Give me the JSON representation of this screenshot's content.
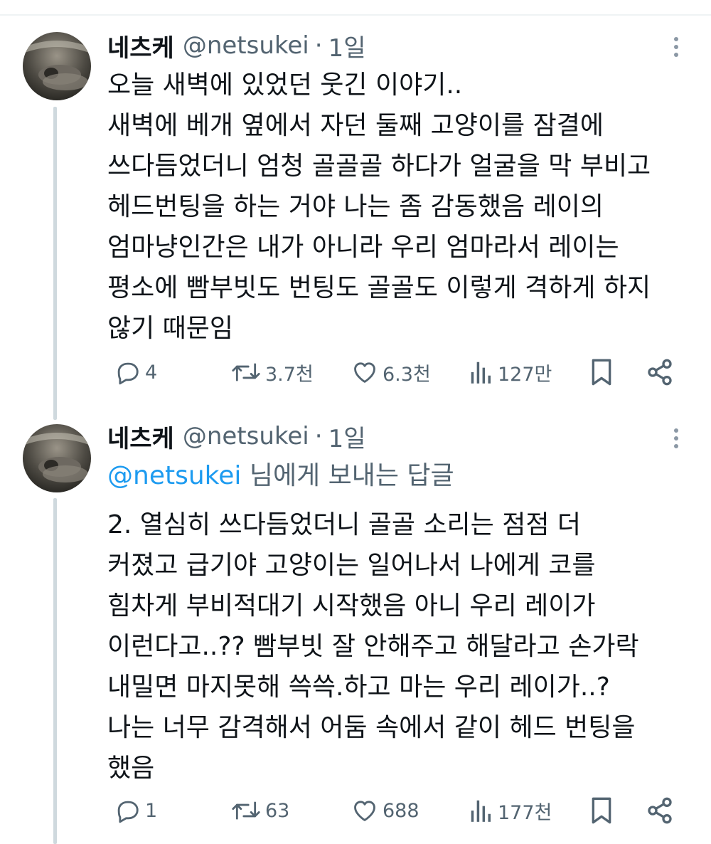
{
  "tweets": [
    {
      "name": "네츠케",
      "handle": "@netsukei",
      "dot": "·",
      "time": "1일",
      "text": "오늘 새벽에 있었던 웃긴 이야기..\n새벽에 베개 옆에서 자던 둘째 고양이를 잠결에\n쓰다듬었더니 엄청 골골골 하다가 얼굴을 막 부비고\n헤드번팅을 하는 거야 나는 좀 감동했음 레이의\n엄마냥인간은 내가 아니라 우리 엄마라서 레이는\n평소에 빰부빗도 번팅도 골골도 이렇게 격하게 하지\n않기 때문임",
      "stats": {
        "replies": "4",
        "retweets": "3.7천",
        "likes": "6.3천",
        "views": "127만"
      }
    },
    {
      "name": "네츠케",
      "handle": "@netsukei",
      "dot": "·",
      "time": "1일",
      "replying_mention": "@netsukei",
      "replying_rest": " 님에게 보내는 답글",
      "text": "2. 열심히 쓰다듬었더니 골골 소리는 점점 더\n커졌고 급기야 고양이는 일어나서 나에게 코를\n힘차게 부비적대기 시작했음 아니 우리 레이가\n이런다고..?? 빰부빗 잘 안해주고 해달라고 손가락\n내밀면 마지못해 쓱쓱.하고 마는 우리 레이가..?\n나는 너무 감격해서 어둠 속에서 같이 헤드 번팅을\n했음",
      "stats": {
        "replies": "1",
        "retweets": "63",
        "likes": "688",
        "views": "177천"
      }
    }
  ],
  "icons": {
    "reply": "reply-icon",
    "retweet": "retweet-icon",
    "like": "heart-icon",
    "views": "views-icon",
    "bookmark": "bookmark-icon",
    "share": "share-icon",
    "more": "more-icon"
  },
  "colors": {
    "link": "#1d9bf0",
    "secondary": "#536471",
    "text": "#0f1419"
  }
}
